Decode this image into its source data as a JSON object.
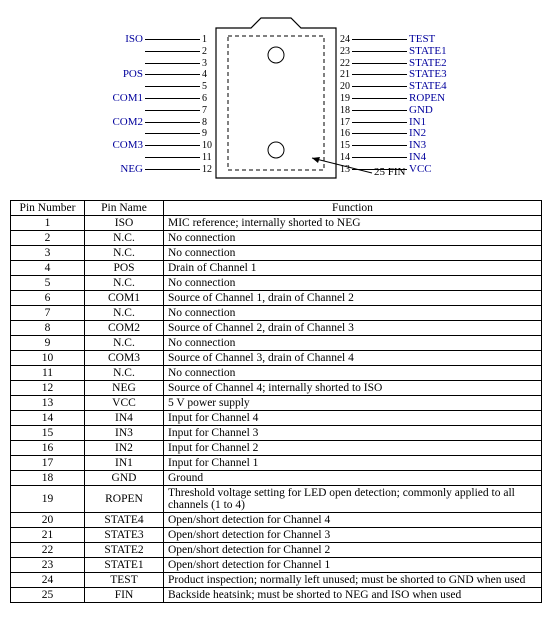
{
  "diagram": {
    "leftPins": [
      {
        "num": "1",
        "name": "ISO"
      },
      {
        "num": "2",
        "name": ""
      },
      {
        "num": "3",
        "name": ""
      },
      {
        "num": "4",
        "name": "POS"
      },
      {
        "num": "5",
        "name": ""
      },
      {
        "num": "6",
        "name": "COM1"
      },
      {
        "num": "7",
        "name": ""
      },
      {
        "num": "8",
        "name": "COM2"
      },
      {
        "num": "9",
        "name": ""
      },
      {
        "num": "10",
        "name": "COM3"
      },
      {
        "num": "11",
        "name": ""
      },
      {
        "num": "12",
        "name": "NEG"
      }
    ],
    "rightPins": [
      {
        "num": "24",
        "name": "TEST"
      },
      {
        "num": "23",
        "name": "STATE1"
      },
      {
        "num": "22",
        "name": "STATE2"
      },
      {
        "num": "21",
        "name": "STATE3"
      },
      {
        "num": "20",
        "name": "STATE4"
      },
      {
        "num": "19",
        "name": "ROPEN"
      },
      {
        "num": "18",
        "name": "GND"
      },
      {
        "num": "17",
        "name": "IN1"
      },
      {
        "num": "16",
        "name": "IN2"
      },
      {
        "num": "15",
        "name": "IN3"
      },
      {
        "num": "14",
        "name": "IN4"
      },
      {
        "num": "13",
        "name": "VCC"
      }
    ],
    "fin": {
      "num": "25",
      "label": "FIN"
    }
  },
  "table": {
    "headers": {
      "num": "Pin Number",
      "name": "Pin Name",
      "func": "Function"
    },
    "rows": [
      {
        "num": "1",
        "name": "ISO",
        "func": "MIC reference; internally shorted to NEG"
      },
      {
        "num": "2",
        "name": "N.C.",
        "func": "No connection"
      },
      {
        "num": "3",
        "name": "N.C.",
        "func": "No connection"
      },
      {
        "num": "4",
        "name": "POS",
        "func": "Drain of Channel 1"
      },
      {
        "num": "5",
        "name": "N.C.",
        "func": "No connection"
      },
      {
        "num": "6",
        "name": "COM1",
        "func": "Source of Channel 1, drain of Channel 2"
      },
      {
        "num": "7",
        "name": "N.C.",
        "func": "No connection"
      },
      {
        "num": "8",
        "name": "COM2",
        "func": "Source of Channel 2, drain of Channel 3"
      },
      {
        "num": "9",
        "name": "N.C.",
        "func": "No connection"
      },
      {
        "num": "10",
        "name": "COM3",
        "func": "Source of Channel 3, drain of Channel 4"
      },
      {
        "num": "11",
        "name": "N.C.",
        "func": "No connection"
      },
      {
        "num": "12",
        "name": "NEG",
        "func": "Source of Channel 4; internally shorted to ISO"
      },
      {
        "num": "13",
        "name": "VCC",
        "func": "5 V power supply"
      },
      {
        "num": "14",
        "name": "IN4",
        "func": "Input for Channel 4"
      },
      {
        "num": "15",
        "name": "IN3",
        "func": "Input for Channel 3"
      },
      {
        "num": "16",
        "name": "IN2",
        "func": "Input for Channel 2"
      },
      {
        "num": "17",
        "name": "IN1",
        "func": "Input for Channel 1"
      },
      {
        "num": "18",
        "name": "GND",
        "func": "Ground"
      },
      {
        "num": "19",
        "name": "ROPEN",
        "func": "Threshold voltage setting for LED open detection; commonly applied to all channels (1 to 4)"
      },
      {
        "num": "20",
        "name": "STATE4",
        "func": "Open/short detection for Channel 4"
      },
      {
        "num": "21",
        "name": "STATE3",
        "func": "Open/short detection for Channel 3"
      },
      {
        "num": "22",
        "name": "STATE2",
        "func": "Open/short detection for Channel 2"
      },
      {
        "num": "23",
        "name": "STATE1",
        "func": "Open/short detection for Channel 1"
      },
      {
        "num": "24",
        "name": "TEST",
        "func": "Product inspection; normally left unused; must be shorted to GND when used"
      },
      {
        "num": "25",
        "name": "FIN",
        "func": "Backside heatsink; must be shorted to NEG and ISO when used"
      }
    ]
  }
}
